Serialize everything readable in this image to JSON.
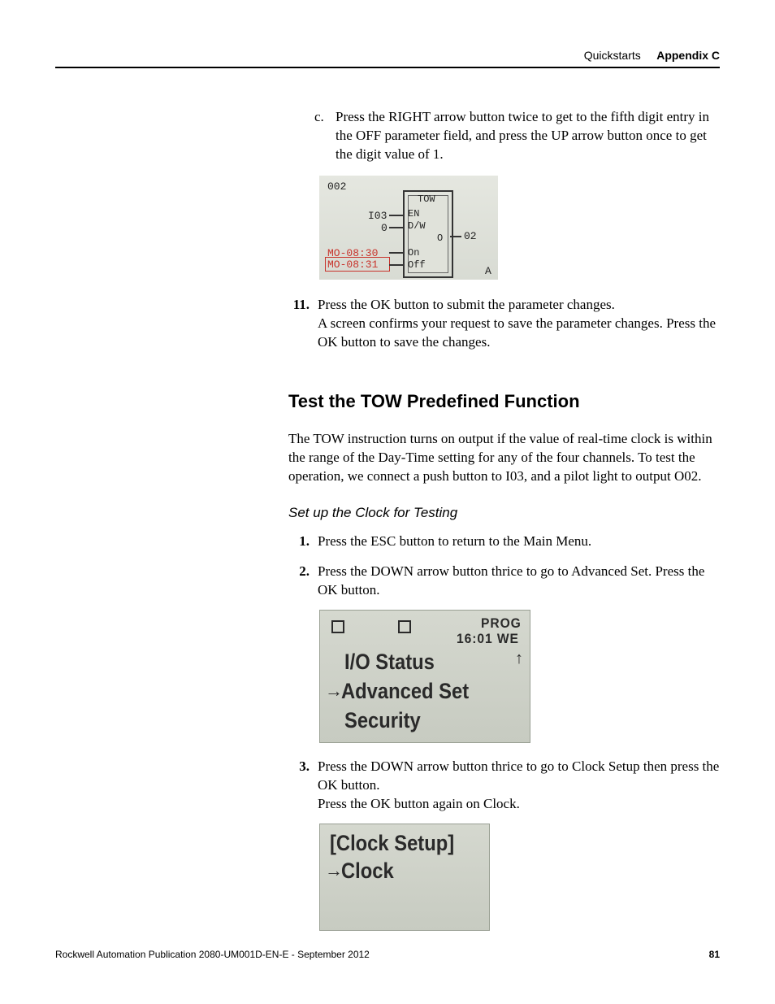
{
  "header": {
    "section": "Quickstarts",
    "appendix": "Appendix C"
  },
  "step_c": {
    "label": "c.",
    "text": "Press the RIGHT arrow button twice to get to the fifth digit entry in the OFF parameter field, and press the UP arrow button once to get the digit value of 1."
  },
  "shot1": {
    "line_002": "002",
    "i03": "I03",
    "zero": "0",
    "on_line": "MO-08:30",
    "off_line": "MO-08:31",
    "tow": "TOW",
    "en": "EN",
    "dw": "D/W",
    "o": "O",
    "on": "On",
    "off": "Off",
    "out": "02",
    "a": "A"
  },
  "step_11": {
    "num": "11.",
    "l1": "Press the OK button to submit the parameter changes.",
    "l2": "A screen confirms your request to save the parameter changes. Press the OK button to save the changes."
  },
  "h2": "Test the TOW Predefined Function",
  "para1": "The TOW instruction turns on output if the value of real-time clock is within the range of the Day-Time setting for any of the four channels. To test the operation, we connect a push button to I03, and a pilot light to output O02.",
  "h3": "Set up the Clock for Testing",
  "step_1": {
    "num": "1.",
    "text": "Press the ESC button to return to the Main Menu."
  },
  "step_2": {
    "num": "2.",
    "text": "Press the DOWN arrow button thrice to go to Advanced Set. Press the OK button."
  },
  "lcd2": {
    "prog": "PROG",
    "time": "16:01 WE",
    "line1": "I/O Status",
    "line2": "Advanced Set",
    "line3": "Security",
    "arrow": "→"
  },
  "step_3": {
    "num": "3.",
    "text": "Press the DOWN arrow button thrice to go to Clock Setup then press the OK button.",
    "text2": "Press the OK button again on Clock."
  },
  "lcd3": {
    "title": "[Clock Setup]",
    "line1": "Clock",
    "arrow": "→"
  },
  "footer": {
    "pub": "Rockwell Automation Publication 2080-UM001D-EN-E - September 2012",
    "page": "81"
  }
}
